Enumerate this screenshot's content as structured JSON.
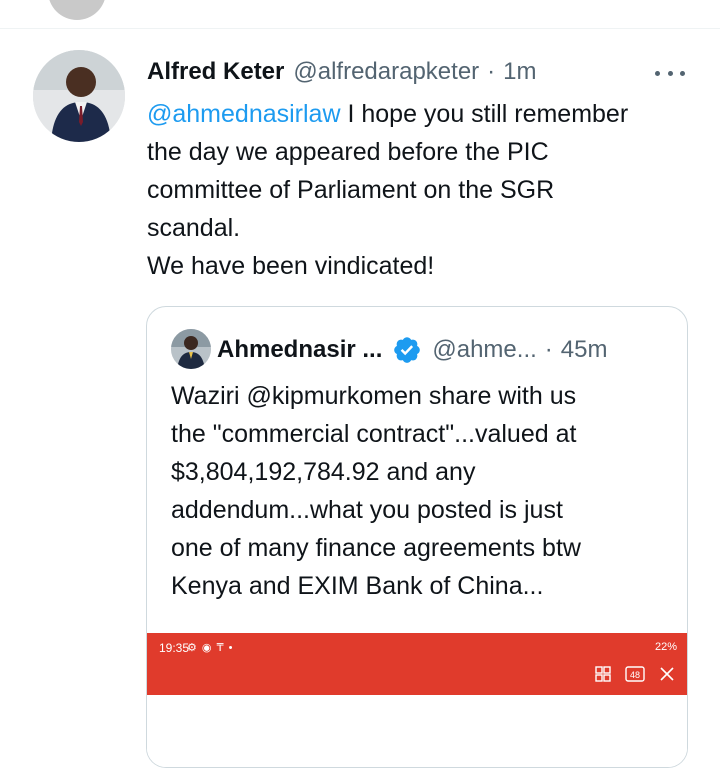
{
  "tweet": {
    "author_name": "Alfred Keter",
    "author_handle": "@alfredarapketer",
    "separator": "·",
    "time": "1m",
    "mention": "@ahmednasirlaw",
    "line1_rest": " I hope you still remember",
    "line2": "the day we appeared before the PIC",
    "line3": "committee of Parliament on the SGR",
    "line4": "scandal.",
    "line5": "We have been vindicated!"
  },
  "quote": {
    "author_name": "Ahmednasir ...",
    "author_handle": "@ahme...",
    "separator": "·",
    "time": "45m",
    "line1": "Waziri @kipmurkomen share with us",
    "line2": "the \"commercial contract\"...valued at",
    "line3": "$3,804,192,784.92 and any",
    "line4": "addendum...what you posted is just",
    "line5": "one of many finance agreements btw",
    "line6": "Kenya and EXIM Bank of China...",
    "media": {
      "status_time": "19:35",
      "status_icons": "⚙ ◉ ₸ •",
      "status_right": "22%",
      "tab_count": "48",
      "bar_color": "#e03b2c"
    }
  },
  "colors": {
    "accent": "#1d9bf0",
    "secondary_text": "#536471",
    "border": "#cfd9de"
  }
}
